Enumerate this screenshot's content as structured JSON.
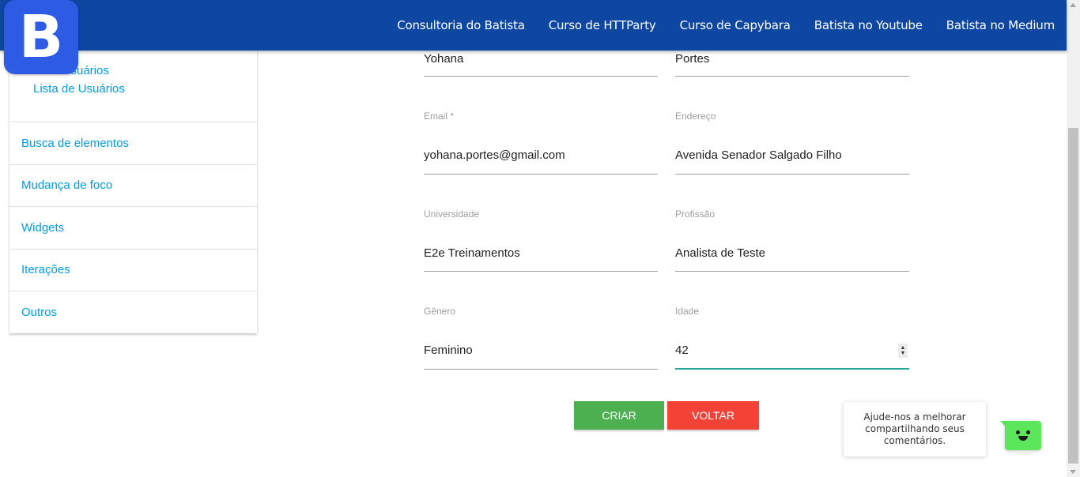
{
  "navbar": {
    "links": [
      "Consultoria do Batista",
      "Curso de HTTParty",
      "Curso de Capybara",
      "Batista no Youtube",
      "Batista no Medium"
    ]
  },
  "logo": {
    "letter": "B"
  },
  "sidebar": {
    "submenu": [
      "Criar Usuários",
      "Lista de Usuários"
    ],
    "items": [
      "Busca de elementos",
      "Mudança de foco",
      "Widgets",
      "Iterações",
      "Outros"
    ]
  },
  "form": {
    "nome": {
      "value": "Yohana"
    },
    "ultimo_nome": {
      "value": "Portes"
    },
    "email": {
      "label": "Email *",
      "value": "yohana.portes@gmail.com"
    },
    "endereco": {
      "label": "Endereço",
      "value": "Avenida Senador Salgado Filho"
    },
    "universidade": {
      "label": "Universidade",
      "value": "E2e Treinamentos"
    },
    "profissao": {
      "label": "Profissão",
      "value": "Analista de Teste"
    },
    "genero": {
      "label": "Gênero",
      "value": "Feminino"
    },
    "idade": {
      "label": "Idade",
      "value": "42"
    }
  },
  "buttons": {
    "create": "CRIAR",
    "back": "VOLTAR"
  },
  "feedback": {
    "text": "Ajude-nos a melhorar compartilhando seus comentários."
  },
  "colors": {
    "navbar": "#0d47a1",
    "link": "#039be5",
    "create": "#4caf50",
    "back": "#f44336",
    "active_underline": "#26a69a",
    "feedback": "#5ce65c"
  }
}
